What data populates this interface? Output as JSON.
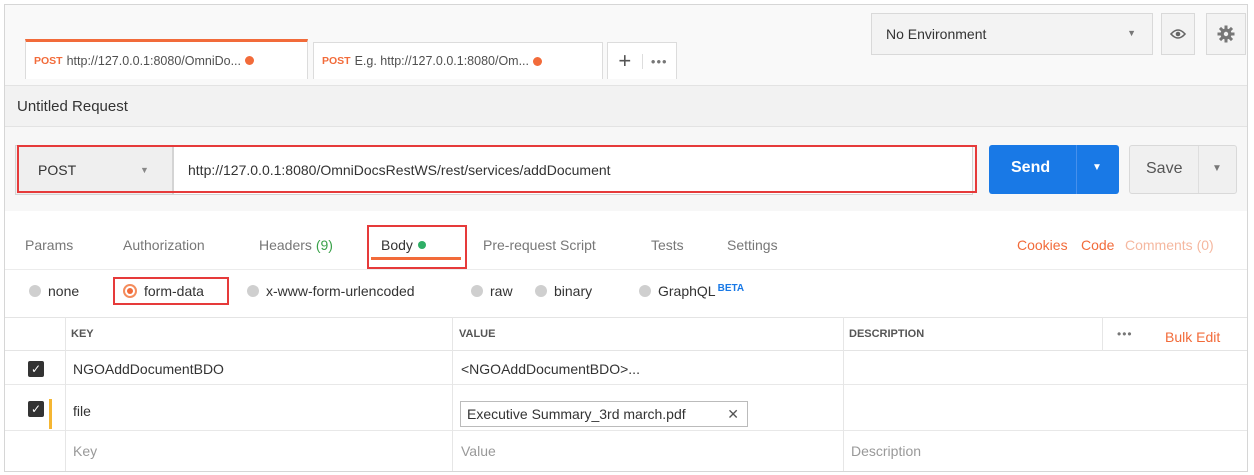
{
  "tabs": [
    {
      "method": "POST",
      "url": "http://127.0.0.1:8080/OmniDo..."
    },
    {
      "method": "POST",
      "url": "E.g. http://127.0.0.1:8080/Om..."
    }
  ],
  "tab_controls": {
    "plus": "+",
    "more": "•••"
  },
  "environment": {
    "selected": "No Environment"
  },
  "request": {
    "title": "Untitled Request",
    "method": "POST",
    "url": "http://127.0.0.1:8080/OmniDocsRestWS/rest/services/addDocument"
  },
  "buttons": {
    "send": "Send",
    "save": "Save"
  },
  "request_tabs": [
    {
      "label": "Params"
    },
    {
      "label": "Authorization"
    },
    {
      "label": "Headers",
      "count": "(9)"
    },
    {
      "label": "Body"
    },
    {
      "label": "Pre-request Script"
    },
    {
      "label": "Tests"
    },
    {
      "label": "Settings"
    }
  ],
  "right_links": {
    "cookies": "Cookies",
    "code": "Code",
    "comments": "Comments (0)"
  },
  "body_types": [
    {
      "label": "none"
    },
    {
      "label": "form-data",
      "selected": true
    },
    {
      "label": "x-www-form-urlencoded"
    },
    {
      "label": "raw"
    },
    {
      "label": "binary"
    },
    {
      "label": "GraphQL",
      "badge": "BETA"
    }
  ],
  "table": {
    "headers": {
      "key": "KEY",
      "value": "VALUE",
      "description": "DESCRIPTION",
      "bulk_edit": "Bulk Edit",
      "more": "•••"
    },
    "rows": [
      {
        "key": "NGOAddDocumentBDO",
        "value": "<NGOAddDocumentBDO>..."
      },
      {
        "key": "file",
        "value": "Executive Summary_3rd march.pdf"
      }
    ],
    "placeholders": {
      "key": "Key",
      "value": "Value",
      "description": "Description"
    }
  },
  "colors": {
    "accent": "#f26b3a",
    "send": "#1979e6",
    "highlight": "#e63a3a",
    "body_dot": "#2fae66"
  }
}
